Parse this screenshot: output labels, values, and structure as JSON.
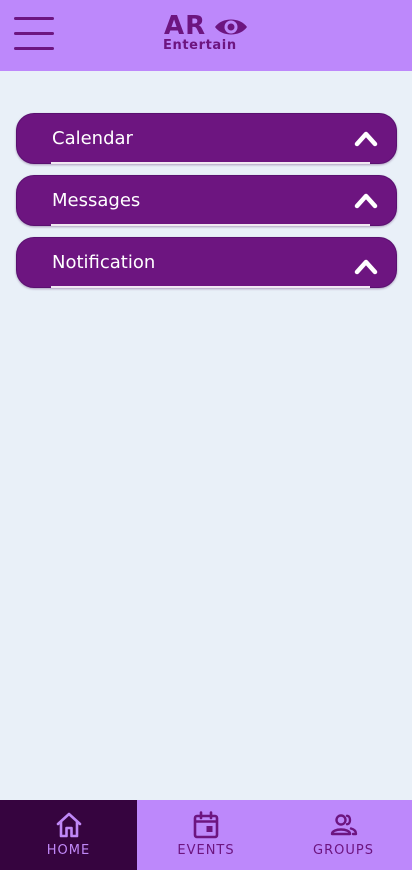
{
  "header": {
    "logo_main": "AR",
    "logo_sub": "Entertain",
    "menu_icon": "hamburger-menu-icon",
    "eye_icon": "eye-logo-icon"
  },
  "sections": [
    {
      "label": "Calendar",
      "icon": "chevron-up-icon"
    },
    {
      "label": "Messages",
      "icon": "chevron-up-icon"
    },
    {
      "label": "Notification",
      "icon": "chevron-up-icon"
    }
  ],
  "bottom_nav": {
    "items": [
      {
        "label": "HOME",
        "icon": "home-icon",
        "active": true
      },
      {
        "label": "EVENTS",
        "icon": "calendar-icon",
        "active": false
      },
      {
        "label": "GROUPS",
        "icon": "people-icon",
        "active": false
      }
    ]
  },
  "colors": {
    "header_bg": "#bd88fb",
    "accent": "#6d1580",
    "page_bg": "#e9f0f8",
    "nav_active_bg": "#36043f",
    "nav_active_text": "#c088f7"
  }
}
